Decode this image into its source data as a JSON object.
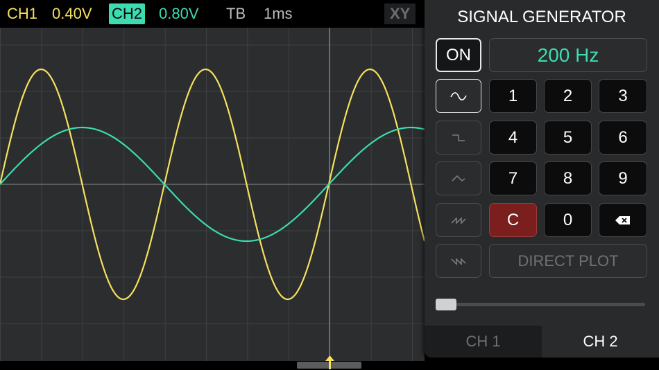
{
  "topbar": {
    "ch1_label": "CH1",
    "ch1_value": "0.40V",
    "ch2_label": "CH2",
    "ch2_value": "0.80V",
    "tb_label": "TB",
    "tb_value": "1ms",
    "xy_label": "XY"
  },
  "colors": {
    "ch1": "#f6e15e",
    "ch2": "#3ddbb0",
    "clear": "#7a1e1e",
    "grid": "#3f4244"
  },
  "panel": {
    "title": "SIGNAL GENERATOR",
    "on_label": "ON",
    "frequency": "200 Hz",
    "waveforms": [
      "sine-wave",
      "square-wave",
      "triangle-wave",
      "sawtooth-wave",
      "reverse-sawtooth-wave"
    ],
    "selected_waveform": "sine-wave",
    "keys": [
      "1",
      "2",
      "3",
      "4",
      "5",
      "6",
      "7",
      "8",
      "9",
      "C",
      "0"
    ],
    "backspace_icon": "backspace-icon",
    "direct_plot_label": "DIRECT PLOT",
    "amplitude_slider_level": 0.0,
    "tabs": [
      "CH 1",
      "CH 2"
    ],
    "active_tab": "CH 2"
  }
}
